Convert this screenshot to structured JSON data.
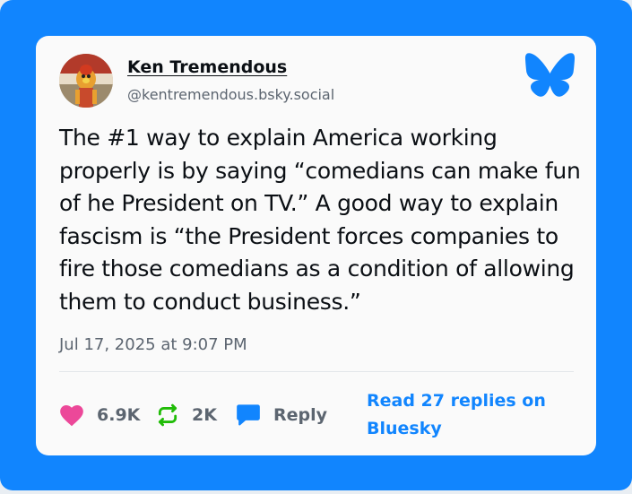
{
  "post": {
    "author_name": "Ken Tremendous",
    "author_handle": "@kentremendous.bsky.social",
    "text": "The #1 way to explain America working\nproperly is by saying “comedians can make fun\nof he President on TV.” A good way to explain\nfascism is “the President forces companies to\nfire those comedians as a condition of allowing\nthem to conduct business.”",
    "timestamp": "Jul 17, 2025 at 9:07 PM"
  },
  "actions": {
    "likes": "6.9K",
    "reposts": "2K",
    "reply_label": "Reply",
    "read_replies_label": "Read 27 replies on Bluesky"
  },
  "icons": {
    "logo": "bluesky-butterfly-icon",
    "like": "heart-icon",
    "repost": "repost-icon",
    "reply": "speech-bubble-icon"
  },
  "colors": {
    "frame": "#1185fe",
    "card": "#fafafa",
    "heart": "#ec4899",
    "repost": "#20bc07",
    "link": "#1185fe",
    "muted": "#5c6570"
  }
}
